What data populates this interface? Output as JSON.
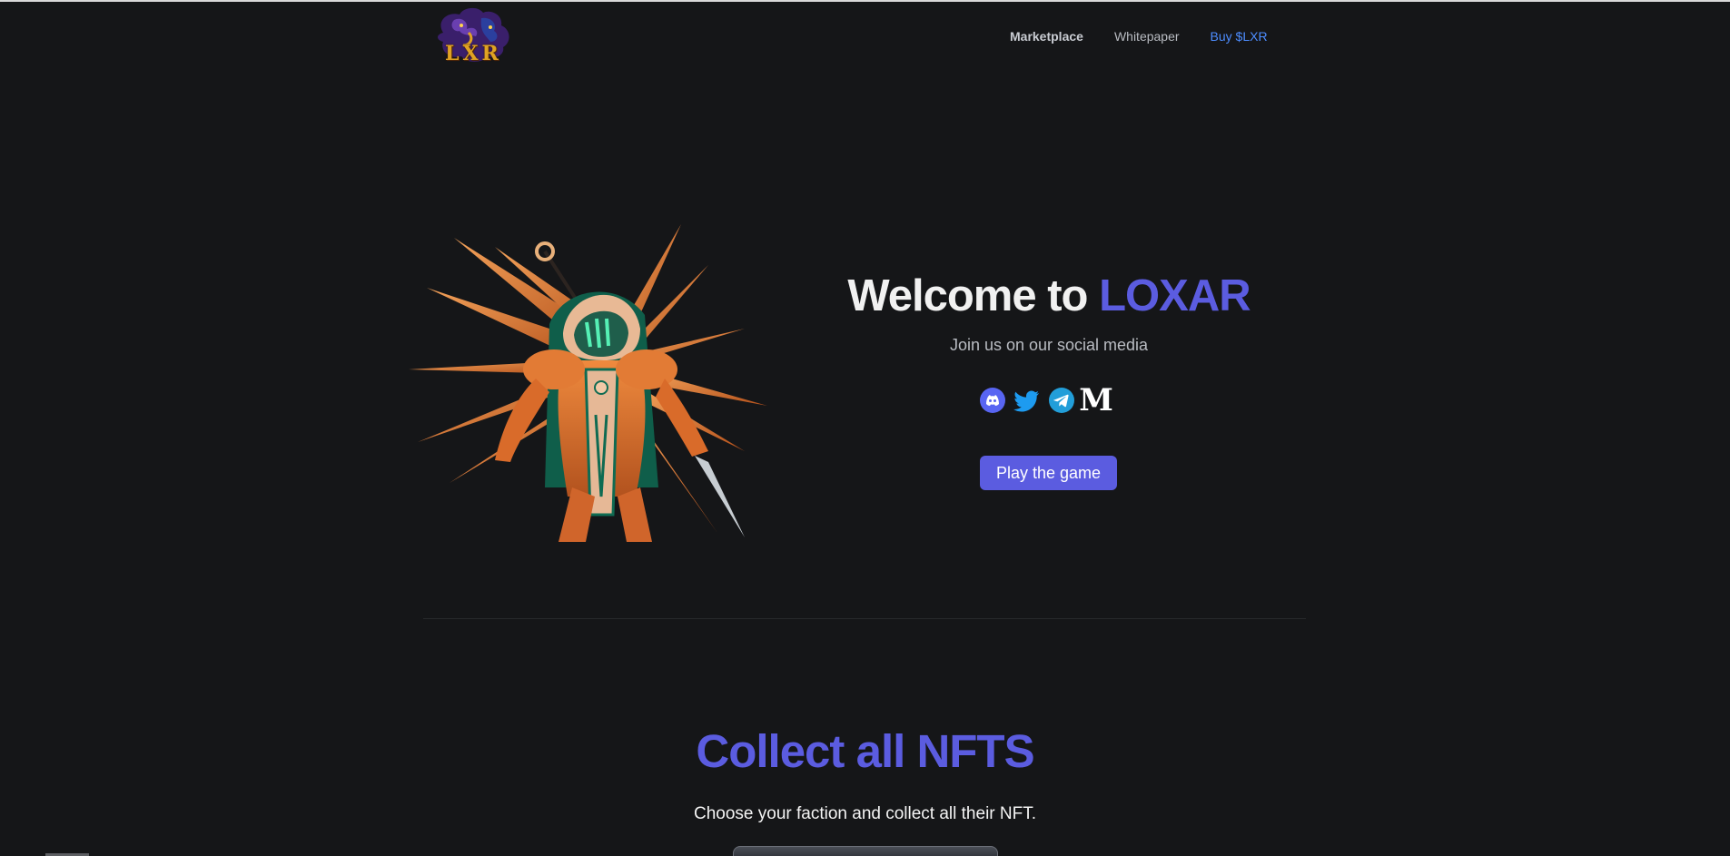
{
  "header": {
    "logo_text": "LXR",
    "nav": {
      "marketplace": "Marketplace",
      "whitepaper": "Whitepaper",
      "buy": "Buy $LXR"
    }
  },
  "hero": {
    "title_prefix": "Welcome to ",
    "title_accent": "LOXAR",
    "subtitle": "Join us on our social media",
    "socials": [
      "discord-icon",
      "twitter-icon",
      "telegram-icon",
      "medium-icon"
    ],
    "medium_glyph": "M",
    "play_button": "Play the game"
  },
  "collect": {
    "title": "Collect all NFTS",
    "subtitle": "Choose your faction and collect all their NFT."
  },
  "colors": {
    "background": "#151618",
    "accent": "#5b5ce0",
    "buy_link": "#4d8dff"
  }
}
